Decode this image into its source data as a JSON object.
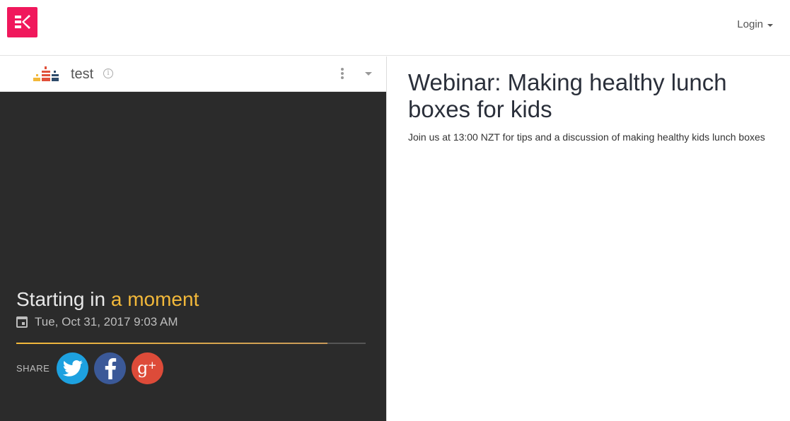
{
  "header": {
    "logo_icon": "brand-logo-icon",
    "brand_color": "#f0185c",
    "login_label": "Login"
  },
  "channel": {
    "name": "test",
    "icon": "podium-bars-icon",
    "info_icon": "info-icon",
    "menu_icon": "kebab-menu-icon",
    "expand_icon": "chevron-down-icon"
  },
  "player": {
    "starting_prefix": "Starting in",
    "starting_highlight": "a moment",
    "date_icon": "calendar-icon",
    "date": "Tue, Oct 31, 2017 9:03 AM",
    "progress_fraction": 0.89,
    "share_label": "SHARE",
    "share_buttons": [
      {
        "name": "twitter-icon",
        "color": "#1da1e0"
      },
      {
        "name": "facebook-icon",
        "color": "#3b5998"
      },
      {
        "name": "google-plus-icon",
        "color": "#dd4b39"
      }
    ],
    "accent_color": "#f2b83a"
  },
  "event": {
    "title": "Webinar: Making healthy lunch boxes for kids",
    "description": "Join us at 13:00 NZT for tips and a discussion of making healthy kids lunch boxes"
  }
}
